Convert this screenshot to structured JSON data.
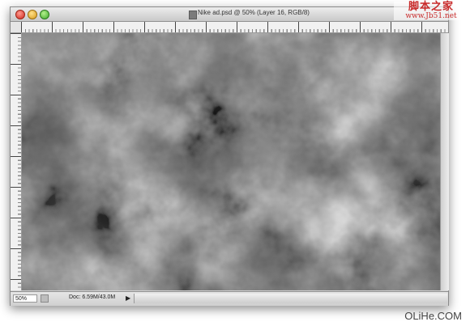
{
  "window": {
    "title": "Nike ad.psd @ 50% (Layer 16, RGB/8)"
  },
  "statusbar": {
    "zoom": "50%",
    "doc_info": "Doc: 6.59M/43.0M",
    "arrow": "▶"
  },
  "watermarks": {
    "top_line1": "脚本之家",
    "top_line2": "www.Jb51.net",
    "bottom": "OLiHe.COM"
  },
  "canvas": {
    "content": "clouds-texture",
    "colors": {
      "dark": "#0a0a0a",
      "light": "#e8e8e8"
    }
  },
  "icons": {
    "close": "close-button-icon",
    "minimize": "minimize-button-icon",
    "zoom": "zoom-button-icon",
    "document": "document-icon"
  }
}
